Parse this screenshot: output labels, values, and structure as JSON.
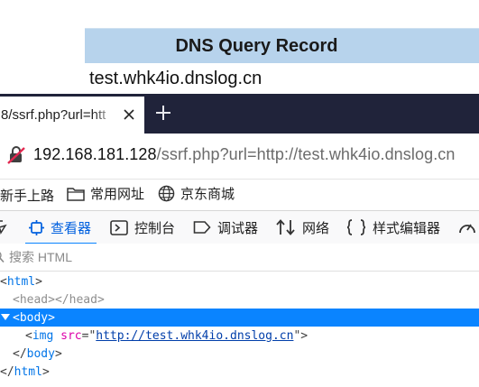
{
  "dns": {
    "header": "DNS Query Record",
    "record": "test.whk4io.dnslog.cn"
  },
  "browser": {
    "tab_title": "8/ssrf.php?url=htt",
    "address": {
      "host": "192.168.181.128",
      "path": "/ssrf.php?url=http://test.whk4io.dnslog.cn"
    },
    "bookmarks": [
      "新手上路",
      "常用网址",
      "京东商城"
    ]
  },
  "devtools": {
    "tabs": [
      "查看器",
      "控制台",
      "调试器",
      "网络",
      "样式编辑器"
    ],
    "search_placeholder": "搜索 HTML",
    "markup": {
      "html_open": "html",
      "head": "head",
      "body": "body",
      "img_tag": "img",
      "img_attr": "src",
      "img_src": "http://test.whk4io.dnslog.cn",
      "html_close": "html"
    }
  },
  "colors": {
    "accent": "#0a84ff",
    "tab_strip": "#20233a",
    "dns_header_bg": "#b7d3ec"
  }
}
